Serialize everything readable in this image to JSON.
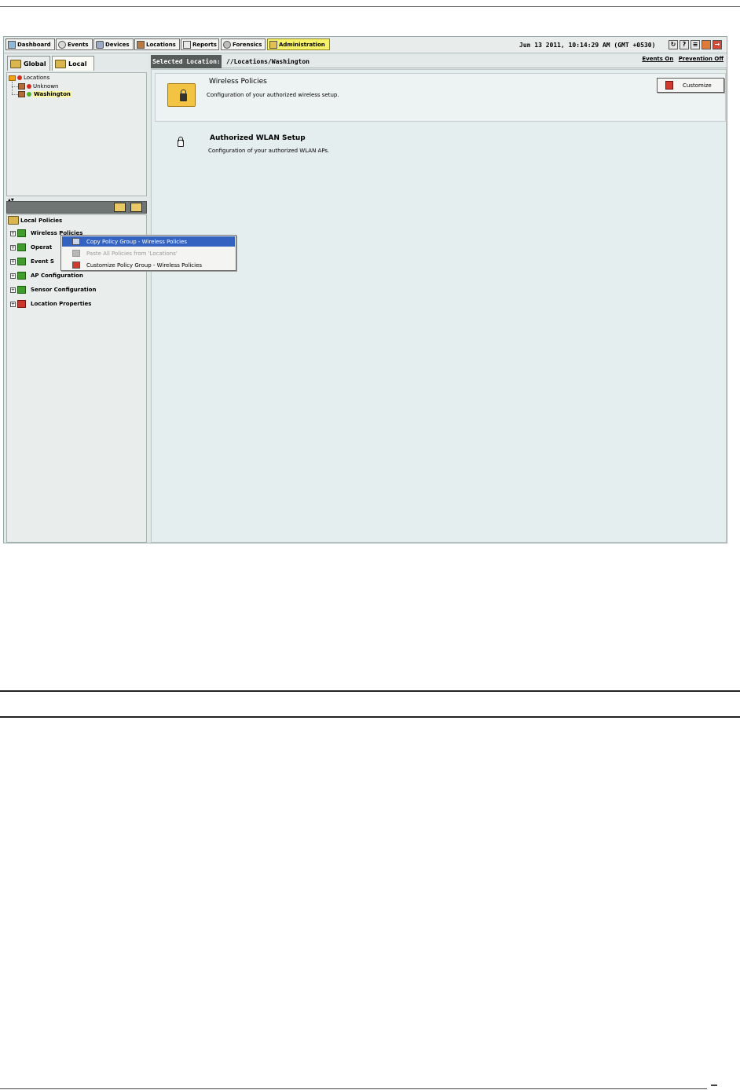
{
  "toolbar": {
    "buttons": [
      {
        "label": "Dashboard",
        "icon": "dashboard-icon"
      },
      {
        "label": "Events",
        "icon": "events-icon"
      },
      {
        "label": "Devices",
        "icon": "devices-icon"
      },
      {
        "label": "Locations",
        "icon": "locations-icon"
      },
      {
        "label": "Reports",
        "icon": "reports-icon"
      },
      {
        "label": "Forensics",
        "icon": "forensics-icon"
      },
      {
        "label": "Administration",
        "icon": "administration-icon",
        "active": true
      }
    ],
    "datetime": "Jun 13 2011, 10:14:29 AM (GMT +0530)",
    "right_icons": [
      "refresh-icon",
      "help-icon",
      "list-icon",
      "shield-icon",
      "exit-icon"
    ]
  },
  "left_panel": {
    "tabs": [
      {
        "label": "Global"
      },
      {
        "label": "Local",
        "active": true
      }
    ],
    "location_tree": {
      "root": "Locations",
      "children": [
        "Unknown",
        "Washington"
      ],
      "selected": "Washington"
    },
    "policy_tree": {
      "root": "Local Policies",
      "items": [
        {
          "label": "Wireless Policies"
        },
        {
          "label": "Operat"
        },
        {
          "label": "Event S"
        },
        {
          "label": "AP Configuration"
        },
        {
          "label": "Sensor Configuration"
        },
        {
          "label": "Location Properties"
        }
      ]
    }
  },
  "context_menu": {
    "items": [
      {
        "label": "Copy Policy Group - Wireless Policies",
        "state": "selected"
      },
      {
        "label": "Paste All Policies from 'Locations'",
        "state": "disabled"
      },
      {
        "label": "Customize Policy Group - Wireless Policies",
        "state": "normal"
      }
    ]
  },
  "right_panel": {
    "selected_location_label": "Selected Location:",
    "selected_location_path": "//Locations/Washington",
    "events_link": "Events On",
    "prevention_link": "Prevention Off",
    "sections": [
      {
        "title": "Wireless Policies",
        "description": "Configuration of your authorized wireless setup.",
        "button": "Customize"
      },
      {
        "title": "Authorized WLAN Setup",
        "description": "Configuration of your authorized WLAN APs."
      }
    ]
  },
  "colors": {
    "active_tab": "#f7f26a",
    "selection": "#3462c0",
    "panel_bg": "#e5eeee"
  }
}
